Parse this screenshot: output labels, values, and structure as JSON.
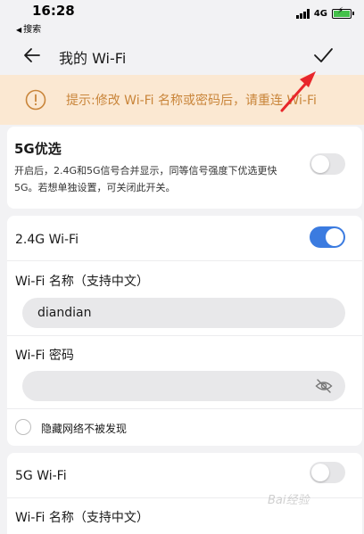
{
  "status": {
    "time": "16:28",
    "back_app": "搜索",
    "network": "4G"
  },
  "header": {
    "title": "我的 Wi-Fi"
  },
  "tip": {
    "text": "提示:修改 Wi-Fi 名称或密码后，请重连 Wi-Fi"
  },
  "preference_5g": {
    "title": "5G优选",
    "description": "开启后，2.4G和5G信号合并显示，同等信号强度下优选更快5G。若想单独设置，可关闭此开关。",
    "enabled": false
  },
  "wifi_24": {
    "label": "2.4G Wi-Fi",
    "enabled": true,
    "name_label": "Wi-Fi 名称（支持中文）",
    "name_value": "diandian",
    "password_label": "Wi-Fi 密码",
    "password_value": "",
    "hide_label": "隐藏网络不被发现"
  },
  "wifi_5g": {
    "label": "5G Wi-Fi",
    "enabled": false,
    "name_label": "Wi-Fi 名称（支持中文）"
  },
  "watermark": "Bai经验",
  "colors": {
    "accent": "#3b7be0",
    "tip_bg": "#fbe8d2",
    "tip_text": "#c9853a",
    "arrow": "#e8262b"
  }
}
